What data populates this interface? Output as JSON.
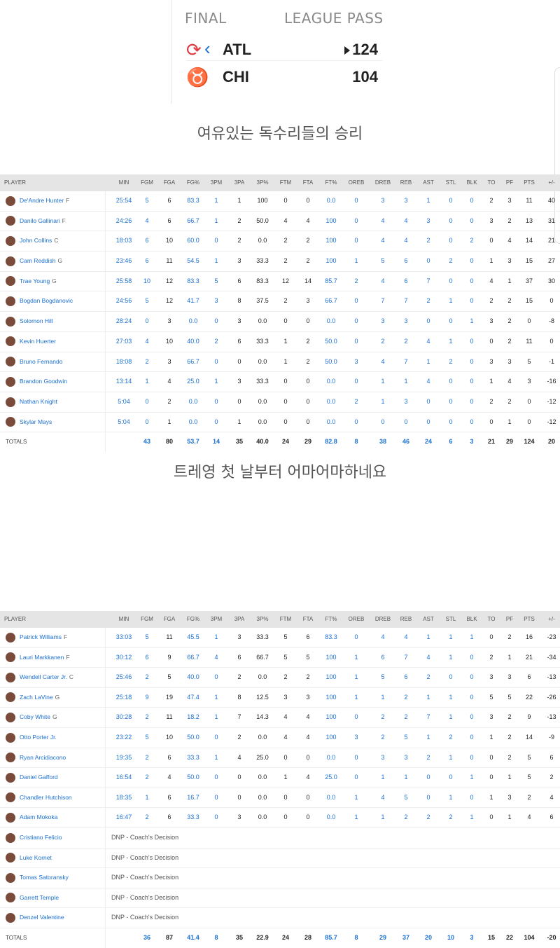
{
  "scoreboard": {
    "status": "FINAL",
    "network": "LEAGUE PASS",
    "teams": [
      {
        "abbr": "ATL",
        "score": "124",
        "winner": true,
        "logo": "hawks-logo"
      },
      {
        "abbr": "CHI",
        "score": "104",
        "winner": false,
        "logo": "bulls-logo"
      }
    ]
  },
  "caption1": "여유있는 독수리들의 승리",
  "caption2": "트레영 첫 날부터 어마어마하네요",
  "columns": [
    "PLAYER",
    "MIN",
    "FGM",
    "FGA",
    "FG%",
    "3PM",
    "3PA",
    "3P%",
    "FTM",
    "FTA",
    "FT%",
    "OREB",
    "DREB",
    "REB",
    "AST",
    "STL",
    "BLK",
    "TO",
    "PF",
    "PTS",
    "+/-"
  ],
  "link_cols": [
    1,
    2,
    4,
    5,
    10,
    11,
    12,
    13,
    14,
    15,
    16
  ],
  "hawks": {
    "players": [
      {
        "name": "De'Andre Hunter",
        "pos": "F",
        "stats": [
          "25:54",
          "5",
          "6",
          "83.3",
          "1",
          "1",
          "100",
          "0",
          "0",
          "0.0",
          "0",
          "3",
          "3",
          "1",
          "0",
          "0",
          "2",
          "3",
          "11",
          "40"
        ]
      },
      {
        "name": "Danilo Gallinari",
        "pos": "F",
        "stats": [
          "24:26",
          "4",
          "6",
          "66.7",
          "1",
          "2",
          "50.0",
          "4",
          "4",
          "100",
          "0",
          "4",
          "4",
          "3",
          "0",
          "0",
          "3",
          "2",
          "13",
          "31"
        ]
      },
      {
        "name": "John Collins",
        "pos": "C",
        "stats": [
          "18:03",
          "6",
          "10",
          "60.0",
          "0",
          "2",
          "0.0",
          "2",
          "2",
          "100",
          "0",
          "4",
          "4",
          "2",
          "0",
          "2",
          "0",
          "4",
          "14",
          "21"
        ]
      },
      {
        "name": "Cam Reddish",
        "pos": "G",
        "stats": [
          "23:46",
          "6",
          "11",
          "54.5",
          "1",
          "3",
          "33.3",
          "2",
          "2",
          "100",
          "1",
          "5",
          "6",
          "0",
          "2",
          "0",
          "1",
          "3",
          "15",
          "27"
        ]
      },
      {
        "name": "Trae Young",
        "pos": "G",
        "stats": [
          "25:58",
          "10",
          "12",
          "83.3",
          "5",
          "6",
          "83.3",
          "12",
          "14",
          "85.7",
          "2",
          "4",
          "6",
          "7",
          "0",
          "0",
          "4",
          "1",
          "37",
          "30"
        ]
      },
      {
        "name": "Bogdan Bogdanovic",
        "pos": "",
        "stats": [
          "24:56",
          "5",
          "12",
          "41.7",
          "3",
          "8",
          "37.5",
          "2",
          "3",
          "66.7",
          "0",
          "7",
          "7",
          "2",
          "1",
          "0",
          "2",
          "2",
          "15",
          "0"
        ]
      },
      {
        "name": "Solomon Hill",
        "pos": "",
        "stats": [
          "28:24",
          "0",
          "3",
          "0.0",
          "0",
          "3",
          "0.0",
          "0",
          "0",
          "0.0",
          "0",
          "3",
          "3",
          "0",
          "0",
          "1",
          "3",
          "2",
          "0",
          "-8"
        ]
      },
      {
        "name": "Kevin Huerter",
        "pos": "",
        "stats": [
          "27:03",
          "4",
          "10",
          "40.0",
          "2",
          "6",
          "33.3",
          "1",
          "2",
          "50.0",
          "0",
          "2",
          "2",
          "4",
          "1",
          "0",
          "0",
          "2",
          "11",
          "0"
        ]
      },
      {
        "name": "Bruno Fernando",
        "pos": "",
        "stats": [
          "18:08",
          "2",
          "3",
          "66.7",
          "0",
          "0",
          "0.0",
          "1",
          "2",
          "50.0",
          "3",
          "4",
          "7",
          "1",
          "2",
          "0",
          "3",
          "3",
          "5",
          "-1"
        ]
      },
      {
        "name": "Brandon Goodwin",
        "pos": "",
        "stats": [
          "13:14",
          "1",
          "4",
          "25.0",
          "1",
          "3",
          "33.3",
          "0",
          "0",
          "0.0",
          "0",
          "1",
          "1",
          "4",
          "0",
          "0",
          "1",
          "4",
          "3",
          "-16"
        ]
      },
      {
        "name": "Nathan Knight",
        "pos": "",
        "stats": [
          "5:04",
          "0",
          "2",
          "0.0",
          "0",
          "0",
          "0.0",
          "0",
          "0",
          "0.0",
          "2",
          "1",
          "3",
          "0",
          "0",
          "0",
          "2",
          "2",
          "0",
          "-12"
        ]
      },
      {
        "name": "Skylar Mays",
        "pos": "",
        "stats": [
          "5:04",
          "0",
          "1",
          "0.0",
          "0",
          "1",
          "0.0",
          "0",
          "0",
          "0.0",
          "0",
          "0",
          "0",
          "0",
          "0",
          "0",
          "0",
          "1",
          "0",
          "-12"
        ]
      }
    ],
    "totals": {
      "label": "TOTALS",
      "stats": [
        "",
        "43",
        "80",
        "53.7",
        "14",
        "35",
        "40.0",
        "24",
        "29",
        "82.8",
        "8",
        "38",
        "46",
        "24",
        "6",
        "3",
        "21",
        "29",
        "124",
        "20"
      ]
    }
  },
  "bulls": {
    "players": [
      {
        "name": "Patrick Williams",
        "pos": "F",
        "stats": [
          "33:03",
          "5",
          "11",
          "45.5",
          "1",
          "3",
          "33.3",
          "5",
          "6",
          "83.3",
          "0",
          "4",
          "4",
          "1",
          "1",
          "1",
          "0",
          "2",
          "16",
          "-23"
        ]
      },
      {
        "name": "Lauri Markkanen",
        "pos": "F",
        "stats": [
          "30:12",
          "6",
          "9",
          "66.7",
          "4",
          "6",
          "66.7",
          "5",
          "5",
          "100",
          "1",
          "6",
          "7",
          "4",
          "1",
          "0",
          "2",
          "1",
          "21",
          "-34"
        ]
      },
      {
        "name": "Wendell Carter Jr.",
        "pos": "C",
        "stats": [
          "25:46",
          "2",
          "5",
          "40.0",
          "0",
          "2",
          "0.0",
          "2",
          "2",
          "100",
          "1",
          "5",
          "6",
          "2",
          "0",
          "0",
          "3",
          "3",
          "6",
          "-13"
        ]
      },
      {
        "name": "Zach LaVine",
        "pos": "G",
        "stats": [
          "25:18",
          "9",
          "19",
          "47.4",
          "1",
          "8",
          "12.5",
          "3",
          "3",
          "100",
          "1",
          "1",
          "2",
          "1",
          "1",
          "0",
          "5",
          "5",
          "22",
          "-26"
        ]
      },
      {
        "name": "Coby White",
        "pos": "G",
        "stats": [
          "30:28",
          "2",
          "11",
          "18.2",
          "1",
          "7",
          "14.3",
          "4",
          "4",
          "100",
          "0",
          "2",
          "2",
          "7",
          "1",
          "0",
          "3",
          "2",
          "9",
          "-13"
        ]
      },
      {
        "name": "Otto Porter Jr.",
        "pos": "",
        "stats": [
          "23:22",
          "5",
          "10",
          "50.0",
          "0",
          "2",
          "0.0",
          "4",
          "4",
          "100",
          "3",
          "2",
          "5",
          "1",
          "2",
          "0",
          "1",
          "2",
          "14",
          "-9"
        ]
      },
      {
        "name": "Ryan Arcidiacono",
        "pos": "",
        "stats": [
          "19:35",
          "2",
          "6",
          "33.3",
          "1",
          "4",
          "25.0",
          "0",
          "0",
          "0.0",
          "0",
          "3",
          "3",
          "2",
          "1",
          "0",
          "0",
          "2",
          "5",
          "6"
        ]
      },
      {
        "name": "Daniel Gafford",
        "pos": "",
        "stats": [
          "16:54",
          "2",
          "4",
          "50.0",
          "0",
          "0",
          "0.0",
          "1",
          "4",
          "25.0",
          "0",
          "1",
          "1",
          "0",
          "0",
          "1",
          "0",
          "1",
          "5",
          "2"
        ]
      },
      {
        "name": "Chandler Hutchison",
        "pos": "",
        "stats": [
          "18:35",
          "1",
          "6",
          "16.7",
          "0",
          "0",
          "0.0",
          "0",
          "0",
          "0.0",
          "1",
          "4",
          "5",
          "0",
          "1",
          "0",
          "1",
          "3",
          "2",
          "4"
        ]
      },
      {
        "name": "Adam Mokoka",
        "pos": "",
        "stats": [
          "16:47",
          "2",
          "6",
          "33.3",
          "0",
          "3",
          "0.0",
          "0",
          "0",
          "0.0",
          "1",
          "1",
          "2",
          "2",
          "2",
          "1",
          "0",
          "1",
          "4",
          "6"
        ]
      }
    ],
    "dnp": [
      {
        "name": "Cristiano Felicio",
        "note": "DNP - Coach's Decision"
      },
      {
        "name": "Luke Kornet",
        "note": "DNP - Coach's Decision"
      },
      {
        "name": "Tomas Satoransky",
        "note": "DNP - Coach's Decision"
      },
      {
        "name": "Garrett Temple",
        "note": "DNP - Coach's Decision"
      },
      {
        "name": "Denzel Valentine",
        "note": "DNP - Coach's Decision"
      }
    ],
    "totals": {
      "label": "TOTALS",
      "stats": [
        "",
        "36",
        "87",
        "41.4",
        "8",
        "35",
        "22.9",
        "24",
        "28",
        "85.7",
        "8",
        "29",
        "37",
        "20",
        "10",
        "3",
        "15",
        "22",
        "104",
        "-20"
      ]
    }
  },
  "colors": {
    "link": "#1a6fd1",
    "header_bg": "#e5e5e5"
  }
}
